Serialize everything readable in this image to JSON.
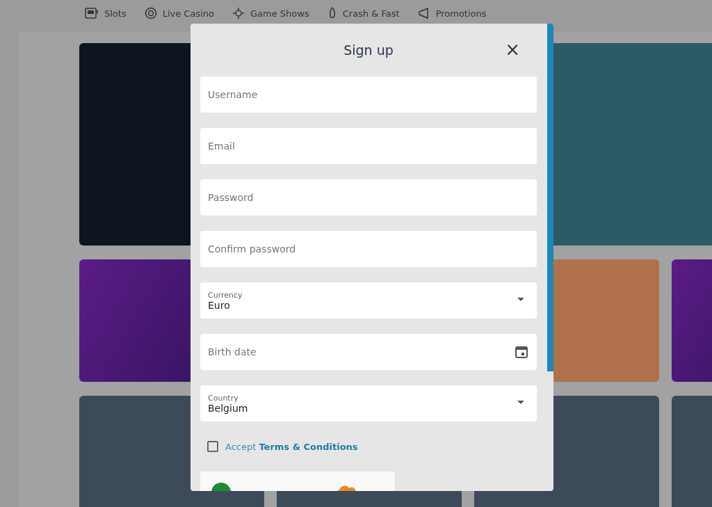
{
  "nav": [
    {
      "label": "Slots"
    },
    {
      "label": "Live Casino"
    },
    {
      "label": "Game Shows"
    },
    {
      "label": "Crash & Fast"
    },
    {
      "label": "Promotions"
    }
  ],
  "dialog": {
    "title": "Sign up",
    "close": "×",
    "fields": [
      {
        "kind": "text",
        "placeholder": "Username"
      },
      {
        "kind": "text",
        "placeholder": "Email"
      },
      {
        "kind": "text",
        "placeholder": "Password"
      },
      {
        "kind": "text",
        "placeholder": "Confirm password"
      },
      {
        "kind": "select",
        "label": "Currency",
        "value": "Euro"
      },
      {
        "kind": "date",
        "placeholder": "Birth date"
      },
      {
        "kind": "select",
        "label": "Country",
        "value": "Belgium"
      }
    ],
    "terms": {
      "checked": false,
      "text": "Accept",
      "link": "Terms & Conditions"
    }
  }
}
